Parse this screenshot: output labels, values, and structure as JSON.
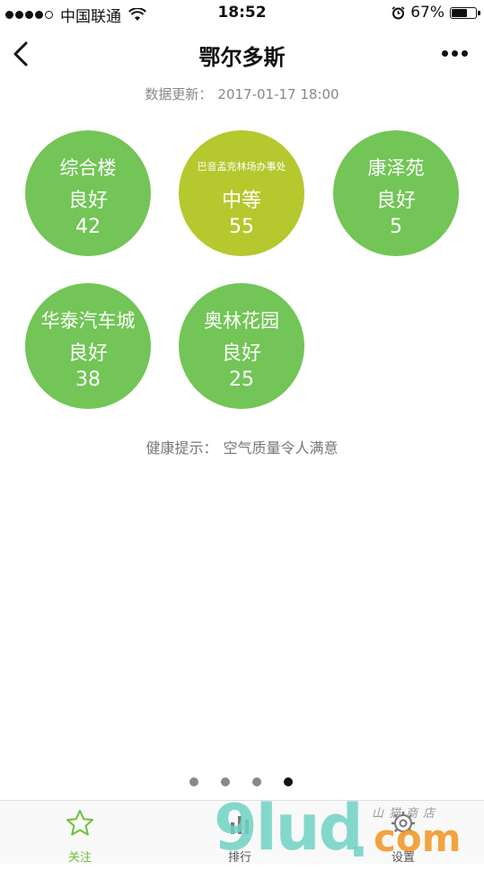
{
  "status_bar": {
    "carrier": "中国联通",
    "time": "18:52",
    "battery": "67%",
    "battery_level": 0.67
  },
  "nav": {
    "title": "鄂尔多斯"
  },
  "update": {
    "label": "数据更新：",
    "time": "2017-01-17 18:00"
  },
  "stations": [
    {
      "name": "综合楼",
      "level": "良好",
      "aqi": "42",
      "color": "#72c556"
    },
    {
      "name": "巴音孟克林场办事处",
      "level": "中等",
      "aqi": "55",
      "color": "#b5c82e"
    },
    {
      "name": "康泽苑",
      "level": "良好",
      "aqi": "5",
      "color": "#72c556"
    },
    {
      "name": "华泰汽车城",
      "level": "良好",
      "aqi": "38",
      "color": "#72c556"
    },
    {
      "name": "奥林花园",
      "level": "良好",
      "aqi": "25",
      "color": "#72c556"
    }
  ],
  "health": {
    "label": "健康提示：",
    "text": "空气质量令人满意"
  },
  "pager": {
    "count": 4,
    "active_index": 3
  },
  "tabs": [
    {
      "label": "关注",
      "icon": "star-icon"
    },
    {
      "label": "排行",
      "icon": "bar-chart-icon"
    },
    {
      "label": "设置",
      "icon": "gear-icon"
    }
  ],
  "watermark": {
    "word": "9lud",
    "suffix": "com",
    "sub": "山猫商店"
  },
  "colors": {
    "good": "#72c556",
    "moderate": "#b5c82e",
    "accent": "#6dc13a"
  }
}
